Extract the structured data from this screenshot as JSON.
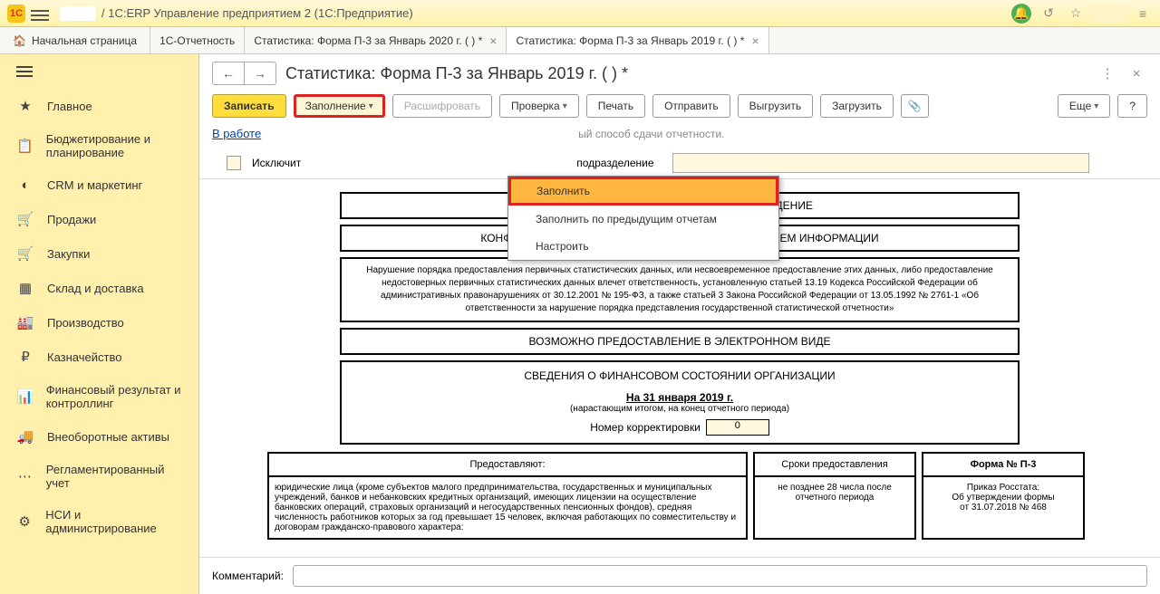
{
  "titlebar": {
    "app_title": "/ 1С:ERP Управление предприятием 2  (1С:Предприятие)"
  },
  "tabs": {
    "home": "Начальная страница",
    "list": [
      "1С-Отчетность",
      "Статистика: Форма П-3 за Январь 2020 г. (                  ) *",
      "Статистика: Форма П-3 за Январь 2019 г. (              ) *"
    ]
  },
  "sidebar": {
    "items": [
      {
        "icon": "≡",
        "label": "Главное"
      },
      {
        "icon": "📋",
        "label": "Бюджетирование и планирование"
      },
      {
        "icon": "◐",
        "label": "CRM и маркетинг"
      },
      {
        "icon": "🛒",
        "label": "Продажи"
      },
      {
        "icon": "🛒",
        "label": "Закупки"
      },
      {
        "icon": "▦",
        "label": "Склад и доставка"
      },
      {
        "icon": "🏭",
        "label": "Производство"
      },
      {
        "icon": "₽",
        "label": "Казначейство"
      },
      {
        "icon": "📊",
        "label": "Финансовый результат и контроллинг"
      },
      {
        "icon": "🚚",
        "label": "Внеоборотные активы"
      },
      {
        "icon": "⋯",
        "label": "Регламентированный учет"
      },
      {
        "icon": "⚙",
        "label": "НСИ и администрирование"
      }
    ]
  },
  "header": {
    "title": "Статистика: Форма П-3 за Январь 2019 г. (                  ) *"
  },
  "toolbar": {
    "save": "Записать",
    "fill": "Заполнение",
    "decode": "Расшифровать",
    "check": "Проверка",
    "print": "Печать",
    "send": "Отправить",
    "export": "Выгрузить",
    "import": "Загрузить",
    "more": "Еще",
    "help": "?"
  },
  "dropdown": {
    "fill": "Заполнить",
    "fill_prev": "Заполнить по предыдущим отчетам",
    "setup": "Настроить"
  },
  "status": {
    "work": "В работе",
    "note": "ый способ сдачи отчетности."
  },
  "exclude": {
    "chk_partial": "Исключит",
    "label": "подразделение"
  },
  "doc": {
    "h1": "ФЕДЕРАЛЬНОЕ СТАТИСТИЧЕСКОЕ НАБЛЮДЕНИЕ",
    "h2": "КОНФИДЕНЦИАЛЬНОСТЬ ГАРАНТИРУЕТСЯ ПОЛУЧАТЕЛЕМ ИНФОРМАЦИИ",
    "warn": "Нарушение порядка предоставления первичных статистических данных, или несвоевременное предоставление этих данных, либо  предоставление недостоверных первичных статистических данных влечет ответственность, установленную статьей 13.19 Кодекса Российской Федерации об административных правонарушениях от 30.12.2001 № 195-ФЗ, а также статьей 3 Закона Российской Федерации от 13.05.1992 № 2761-1 «Об ответственности за нарушение порядка представления государственной статистической отчетности»",
    "h3": "ВОЗМОЖНО ПРЕДОСТАВЛЕНИЕ В ЭЛЕКТРОННОМ ВИДЕ",
    "h4": "СВЕДЕНИЯ О ФИНАНСОВОМ СОСТОЯНИИ ОРГАНИЗАЦИИ",
    "date": "На 31 января 2019 г.",
    "sub": "(нарастающим итогом, на конец отчетного периода)",
    "korr": "Номер корректировки",
    "korr_val": "0",
    "th1": "Предоставляют:",
    "th2": "Сроки предоставления",
    "th3": "Форма № П-3",
    "td1": "юридические лица (кроме субъектов малого предпринимательства, государственных и муниципальных учреждений, банков и небанковских кредитных организаций, имеющих лицензии на осуществление банковских операций, страховых организаций и негосударственных пенсионных фондов), средняя численность работников которых за год превышает 15 человек, включая работающих по совместительству и договорам гражданско-правового характера:",
    "td2": "не позднее 28 числа после отчетного периода",
    "td3a": "Приказ Росстата:",
    "td3b": "Об утверждении формы",
    "td3c": "от 31.07.2018 № 468"
  },
  "comment": {
    "label": "Комментарий:"
  }
}
